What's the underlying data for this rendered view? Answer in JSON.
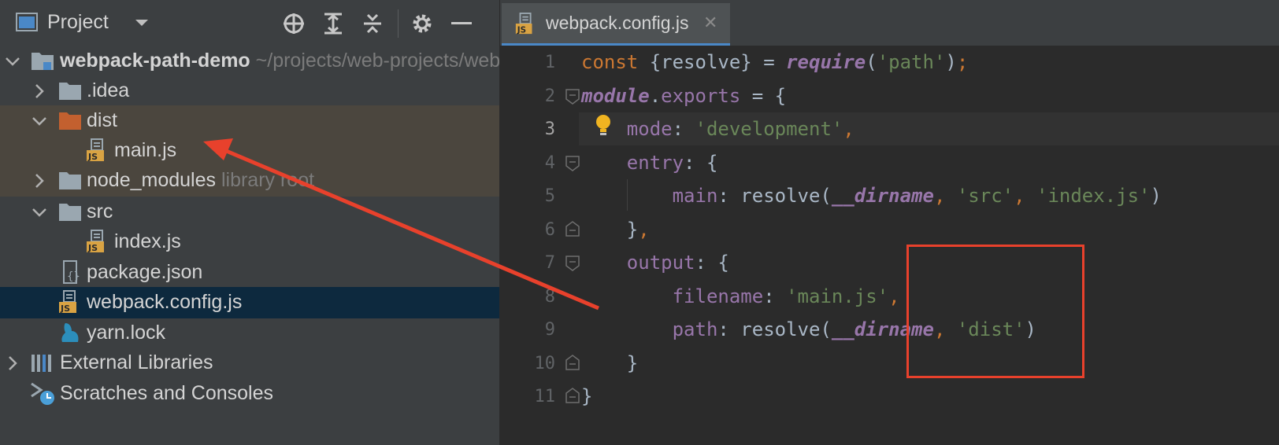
{
  "project_panel": {
    "title": "Project",
    "tree": [
      {
        "label": "webpack-path-demo",
        "hint": "~/projects/web-projects/webpack-path-demo",
        "type": "project-root"
      },
      {
        "label": ".idea",
        "type": "folder"
      },
      {
        "label": "dist",
        "type": "folder-excluded"
      },
      {
        "label": "main.js",
        "type": "js-file"
      },
      {
        "label": "node_modules",
        "hint": "library root",
        "type": "folder"
      },
      {
        "label": "src",
        "type": "folder"
      },
      {
        "label": "index.js",
        "type": "js-file"
      },
      {
        "label": "package.json",
        "type": "json-file"
      },
      {
        "label": "webpack.config.js",
        "type": "js-file"
      },
      {
        "label": "yarn.lock",
        "type": "yarn-file"
      },
      {
        "label": "External Libraries",
        "type": "libraries"
      },
      {
        "label": "Scratches and Consoles",
        "type": "scratches"
      }
    ]
  },
  "editor": {
    "tab_label": "webpack.config.js",
    "tab_icon_text": "JS",
    "line_numbers": [
      "1",
      "2",
      "3",
      "4",
      "5",
      "6",
      "7",
      "8",
      "9",
      "10",
      "11"
    ],
    "current_line": "3"
  },
  "colors": {
    "panel_bg": "#3c3f41",
    "editor_bg": "#2b2b2b",
    "selection": "#0d293e",
    "excluded_folder_bg": "#4b463e",
    "annotation_red": "#e8412c",
    "keyword": "#cc7832",
    "string": "#6a8759",
    "property": "#9876aa"
  }
}
